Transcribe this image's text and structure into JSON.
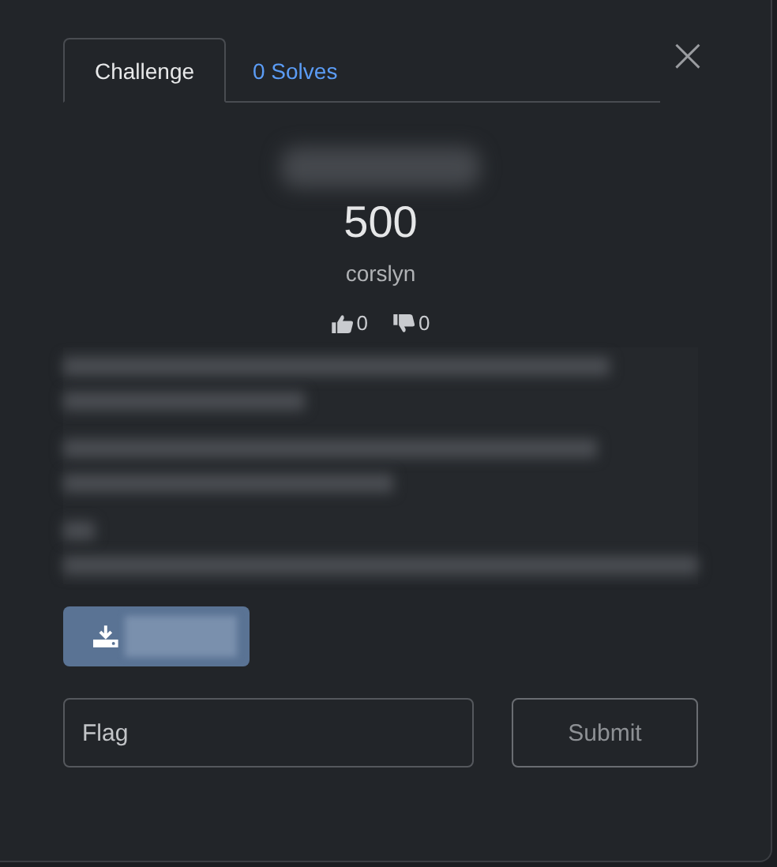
{
  "tabs": [
    {
      "label": "Challenge",
      "selected": true
    },
    {
      "label": "0 Solves",
      "selected": false
    }
  ],
  "close": "×",
  "points": "500",
  "author": "corslyn",
  "votes": {
    "up": "0",
    "down": "0"
  },
  "flag": {
    "placeholder": "Flag"
  },
  "submit": "Submit"
}
